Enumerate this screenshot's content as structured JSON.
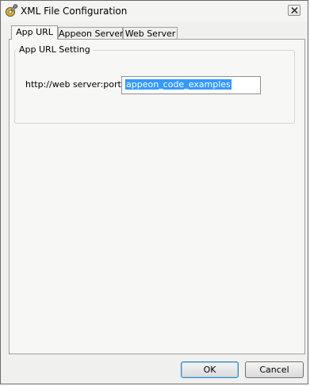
{
  "window": {
    "title": "XML File Configuration",
    "icon": "gear-wrench-icon",
    "close": "close-icon"
  },
  "tabs": [
    {
      "label": "App URL",
      "active": true
    },
    {
      "label": "Appeon Server",
      "active": false
    },
    {
      "label": "Web Server",
      "active": false
    }
  ],
  "app_url": {
    "group_title": "App URL Setting",
    "prefix_label": "http://web server:port/",
    "value": "appeon_code_examples"
  },
  "buttons": {
    "ok": "OK",
    "cancel": "Cancel"
  }
}
